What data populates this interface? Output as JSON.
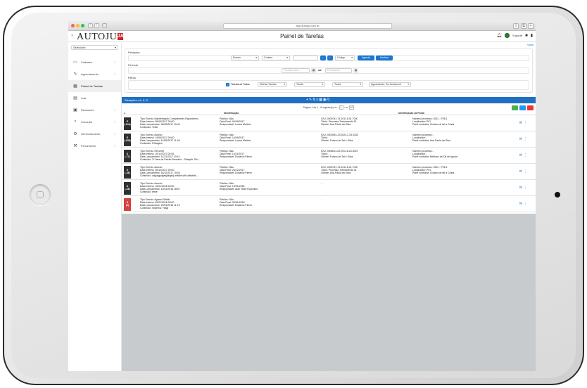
{
  "browser": {
    "url": "app.autojur.com.br"
  },
  "app": {
    "logo": "AUTOJUR",
    "logo_mark": "JA",
    "title": "Painel de Tarefas",
    "user": "Suporte"
  },
  "sidebar": {
    "select_label": "Selecione",
    "items": [
      {
        "label": "Cadastro",
        "icon": "folder-icon"
      },
      {
        "label": "Agendamento",
        "icon": "edit-icon"
      },
      {
        "label": "Painel de Tarefas",
        "icon": "calendar-icon"
      },
      {
        "label": "Lote",
        "icon": "list-icon"
      },
      {
        "label": "Financeiro",
        "icon": "money-icon"
      },
      {
        "label": "Consulta",
        "icon": "search-icon"
      },
      {
        "label": "Gerenciamento",
        "icon": "settings-icon"
      },
      {
        "label": "Ferramenta",
        "icon": "wrench-icon"
      }
    ]
  },
  "main": {
    "voltar": "Voltar"
  },
  "filters": {
    "pesquisa_label": "Pesquisa",
    "evento": "Evento",
    "contem": "Contém",
    "codigo": "Código",
    "agenda_btn": "Agenda",
    "kanban_btn": "Kanban",
    "periodo_label": "Período",
    "periodo_inicio": "Período início",
    "ate": "até",
    "periodo_fim": "Período fim",
    "filtros_label": "Filtros",
    "tarefas_todos": "Tarefas de Todos",
    "minhas_tarefas": "Minhas Tarefas",
    "tarefa": "Tarefa",
    "todos": "Todos",
    "situacao": "Aguardando, Em Andament"
  },
  "table": {
    "bar_title": "Situações • A, K, E",
    "pager": "Página 1 de 1 - 6 registro(s)",
    "page_num": "1",
    "page_size": "10",
    "head": {
      "identificacao": "Identificação",
      "identificacao_pasta": "Identificação da Pasta"
    },
    "colors": {
      "excel": "#4caf50",
      "print": "#2196f3",
      "pdf": "#e53935"
    },
    "rows": [
      {
        "b1": "E",
        "b2": "(-144)",
        "red": false,
        "c1": [
          "Tipo Evento: Manifestação Cumprimento Espontâneo",
          "Data Interna: 06/09/2017 00:00",
          "Data Lançamento: 06/09/2017 15:44",
          "Conteúdo: Teste"
        ],
        "c2": [
          "Público: Não",
          "Data Final: 06/09/2017",
          "Responsável: Luana Martins"
        ],
        "c3": [
          "CNJ: 0000741-74.2011.8.01.7000",
          "Título: Processo Treinamento 01",
          "Cliente: Ana Paula da Silva"
        ],
        "c4": [
          "Número processo: 0312 - P35.1",
          "Localizador: P01",
          "Parte contrária: Ciclano de tal a Costa"
        ]
      },
      {
        "b1": "E",
        "b2": "(-138)",
        "red": false,
        "c1": [
          "Tipo Evento: Acordo",
          "Data Interna: 14/09/2017 00:00",
          "Data Lançamento: 14/09/2017 11:46",
          "Conteúdo: Filtragem"
        ],
        "c2": [
          "Público: Não",
          "Data Final: 14/09/2017",
          "Responsável: Luana Martins"
        ],
        "c3": [
          "CNJ: 0000351-23.2023.2.33.3333",
          "Título: -",
          "Cliente: Fulano de Tal e Silva"
        ],
        "c4": [
          "Número processo: -",
          "Localizador: -",
          "Parte contrária: Ana Paula da Silva"
        ]
      },
      {
        "b1": "K",
        "b2": "(-77)",
        "red": false,
        "c1": [
          "Tipo Evento: Recorrer",
          "Data Interna: 10/11/2017 00:00",
          "Data Lançamento: 14/11/2017 10:41",
          "Conteúdo: 2ª Vara de Direito Bancário - Relação 1Pri..."
        ],
        "c2": [
          "Público: Não",
          "Data Final: 14/11/2017",
          "Responsável: Eduardo Pirera"
        ],
        "c3": [
          "CNJ: 0006011-02.2014.8.24.0023",
          "Título: -",
          "Cliente: Fulano de Tal e Silva"
        ],
        "c4": [
          "Número processo: -",
          "Localizador: -",
          "Parte contrária: Beltrano de Tal de Aguiar"
        ]
      },
      {
        "b1": "K",
        "b2": "(-38)",
        "red": false,
        "c1": [
          "Tipo Evento: Acordo",
          "Data Interna: 26/12/2017 00:00",
          "Data Lançamento: 18/12/2017 15:03",
          "Conteúdo: adjpagpdgasjdkgsdj wdfadf sdf sdfsdfsfs..."
        ],
        "c2": [
          "Público: Não",
          "Data Final: 26/12/2017",
          "Responsável: Eduardo Pirera"
        ],
        "c3": [
          "CNJ: 0000741-74.2011.8.01.7000",
          "Título: Processo Treinamento 01",
          "Cliente: Ana Paula da Silva"
        ],
        "c4": [
          "Número processo: 0312 - P35.1",
          "Localizador: P01",
          "Parte contrária: Ciclano de tal a Costa"
        ]
      },
      {
        "b1": "K",
        "b2": "(-28)",
        "red": false,
        "c1": [
          "Tipo Evento: Acordo",
          "Data Interna: 10/01/2018 00:00",
          "Data Lançamento: 10/01/2018 18:57",
          "Conteúdo: teste"
        ],
        "c2": [
          "Público: Não",
          "Data Final: 10/01/2018",
          "Responsável: Alan Teste Ruponiss"
        ],
        "c3": [
          "-"
        ],
        "c4": []
      },
      {
        "b1": "K",
        "b2": "(0)",
        "red": true,
        "c1": [
          "Tipo Evento: Agravo Retido",
          "Data Interna: 30/01/2018 00:00",
          "Data Lançamento: 29/01/2018 11:10",
          "Conteúdo: Sistema: Flagz"
        ],
        "c2": [
          "Público: Não",
          "Data Final: 30/01/2018",
          "Responsável: Eduardo Pirera"
        ],
        "c3": [
          "-"
        ],
        "c4": []
      }
    ]
  }
}
